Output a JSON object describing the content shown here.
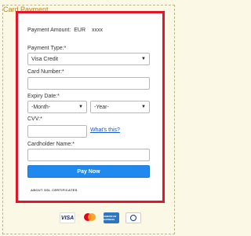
{
  "section": {
    "title": "Card Payment"
  },
  "payment": {
    "amount_label": "Payment Amount:",
    "currency": "EUR",
    "amount": "xxxx"
  },
  "form": {
    "payment_type_label": "Payment Type:*",
    "payment_type_value": "Visa Credit",
    "card_number_label": "Card Number:*",
    "card_number_value": "",
    "expiry_label": "Expiry Date:*",
    "month_value": "-Month-",
    "year_value": "-Year-",
    "cvv_label": "CVV:*",
    "cvv_value": "",
    "whats_this": "What's this?",
    "cardholder_label": "Cardholder Name:*",
    "cardholder_value": "",
    "pay_button": "Pay Now",
    "ssl_link": "ABOUT SSL CERTIFICATES"
  },
  "logos": {
    "visa": "VISA",
    "mastercard_icon": "mastercard-logo",
    "amex": "AMERICAN EXPRESS",
    "diners_icon": "diners-club-logo"
  },
  "colors": {
    "border_accent": "#e0172a",
    "button": "#1f89f0",
    "link": "#1a55cc",
    "legend": "#b38a26"
  }
}
